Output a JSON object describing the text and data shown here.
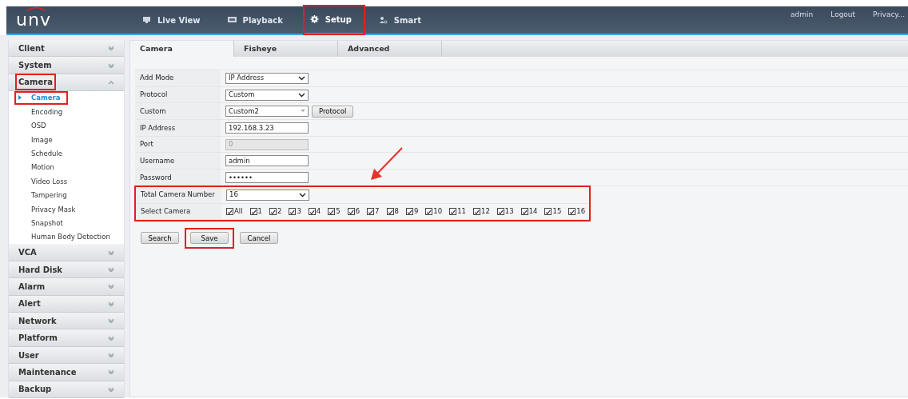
{
  "header": {
    "logo": "unv",
    "nav": [
      {
        "label": "Live View",
        "selected": false,
        "highlighted": false
      },
      {
        "label": "Playback",
        "selected": false,
        "highlighted": false
      },
      {
        "label": "Setup",
        "selected": true,
        "highlighted": true
      },
      {
        "label": "Smart",
        "selected": false,
        "highlighted": false
      }
    ],
    "links": [
      "admin",
      "Logout",
      "Privacy..."
    ]
  },
  "sidebar": {
    "groups": [
      {
        "label": "Client",
        "expanded": false,
        "highlighted": false
      },
      {
        "label": "System",
        "expanded": false,
        "highlighted": false
      },
      {
        "label": "Camera",
        "expanded": true,
        "highlighted": true,
        "children": [
          {
            "label": "Camera",
            "selected": true,
            "highlighted": true
          },
          {
            "label": "Encoding",
            "selected": false,
            "highlighted": false
          },
          {
            "label": "OSD",
            "selected": false,
            "highlighted": false
          },
          {
            "label": "Image",
            "selected": false,
            "highlighted": false
          },
          {
            "label": "Schedule",
            "selected": false,
            "highlighted": false
          },
          {
            "label": "Motion",
            "selected": false,
            "highlighted": false
          },
          {
            "label": "Video Loss",
            "selected": false,
            "highlighted": false
          },
          {
            "label": "Tampering",
            "selected": false,
            "highlighted": false
          },
          {
            "label": "Privacy Mask",
            "selected": false,
            "highlighted": false
          },
          {
            "label": "Snapshot",
            "selected": false,
            "highlighted": false
          },
          {
            "label": "Human Body Detection",
            "selected": false,
            "highlighted": false
          }
        ]
      },
      {
        "label": "VCA",
        "expanded": false,
        "highlighted": false
      },
      {
        "label": "Hard Disk",
        "expanded": false,
        "highlighted": false
      },
      {
        "label": "Alarm",
        "expanded": false,
        "highlighted": false
      },
      {
        "label": "Alert",
        "expanded": false,
        "highlighted": false
      },
      {
        "label": "Network",
        "expanded": false,
        "highlighted": false
      },
      {
        "label": "Platform",
        "expanded": false,
        "highlighted": false
      },
      {
        "label": "User",
        "expanded": false,
        "highlighted": false
      },
      {
        "label": "Maintenance",
        "expanded": false,
        "highlighted": false
      },
      {
        "label": "Backup",
        "expanded": false,
        "highlighted": false
      }
    ]
  },
  "tabs": [
    {
      "label": "Camera",
      "selected": true
    },
    {
      "label": "Fisheye",
      "selected": false
    },
    {
      "label": "Advanced",
      "selected": false
    }
  ],
  "form": {
    "rows": [
      {
        "kind": "select",
        "label": "Add Mode",
        "value": "IP Address",
        "highlighted": false
      },
      {
        "kind": "select",
        "label": "Protocol",
        "value": "Custom",
        "highlighted": false
      },
      {
        "kind": "combo",
        "label": "Custom",
        "value": "Custom2",
        "button": "Protocol",
        "highlighted": false
      },
      {
        "kind": "text",
        "label": "IP Address",
        "value": "192.168.3.23",
        "disabled": false,
        "highlighted": false
      },
      {
        "kind": "text",
        "label": "Port",
        "value": "0",
        "disabled": true,
        "highlighted": false
      },
      {
        "kind": "text",
        "label": "Username",
        "value": "admin",
        "disabled": false,
        "highlighted": false
      },
      {
        "kind": "password",
        "label": "Password",
        "value": "••••••",
        "highlighted": false
      },
      {
        "kind": "select",
        "label": "Total Camera Number",
        "value": "16",
        "highlighted": true
      },
      {
        "kind": "checks",
        "label": "Select Camera",
        "highlighted": true,
        "items": [
          {
            "label": "All",
            "checked": true
          },
          {
            "label": "1",
            "checked": true
          },
          {
            "label": "2",
            "checked": true
          },
          {
            "label": "3",
            "checked": true
          },
          {
            "label": "4",
            "checked": true
          },
          {
            "label": "5",
            "checked": true
          },
          {
            "label": "6",
            "checked": true
          },
          {
            "label": "7",
            "checked": true
          },
          {
            "label": "8",
            "checked": true
          },
          {
            "label": "9",
            "checked": true
          },
          {
            "label": "10",
            "checked": true
          },
          {
            "label": "11",
            "checked": true
          },
          {
            "label": "12",
            "checked": true
          },
          {
            "label": "13",
            "checked": true
          },
          {
            "label": "14",
            "checked": true
          },
          {
            "label": "15",
            "checked": true
          },
          {
            "label": "16",
            "checked": true
          }
        ]
      }
    ]
  },
  "buttons": [
    {
      "label": "Search",
      "highlighted": false
    },
    {
      "label": "Save",
      "highlighted": true
    },
    {
      "label": "Cancel",
      "highlighted": false
    }
  ]
}
